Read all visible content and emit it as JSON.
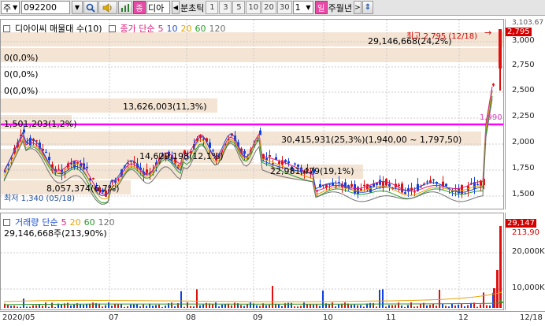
{
  "toolbar": {
    "market": "주",
    "code": "092200",
    "name": "디아",
    "period_label": "분초틱",
    "intervals": [
      "1",
      "3",
      "5",
      "10",
      "20",
      "30"
    ],
    "count": "1",
    "period_tabs": [
      "일",
      "주",
      "월",
      "년"
    ]
  },
  "price_panel": {
    "legend": {
      "stock": "디아이씨 매물대 수(10)",
      "ma_title": "종가 단순",
      "ma_periods": [
        {
          "label": "5",
          "color": "#e0187a"
        },
        {
          "label": "10",
          "color": "#2050d0"
        },
        {
          "label": "20",
          "color": "#e8a000"
        },
        {
          "label": "60",
          "color": "#2a9a2a"
        },
        {
          "label": "120",
          "color": "#707070"
        }
      ]
    },
    "volume_profile": [
      {
        "label": "29,146,668(24,2%)"
      },
      {
        "label": "0(0,0%)"
      },
      {
        "label": "0(0,0%)"
      },
      {
        "label": "0(0,0%)"
      },
      {
        "label": "13,626,003(11,3%)"
      },
      {
        "label": "1,501,203(1,2%)"
      },
      {
        "label": "30,415,931(25,3%)(1,940,00 ~ 1,797,50)"
      },
      {
        "label": "14,629,198(12,1%)"
      },
      {
        "label": "22,981,479(19,1%)"
      },
      {
        "label": "8,057,374(6,7%)"
      }
    ],
    "high_label": "최고 2,795 (12/18)",
    "low_label": "최저 1,340 (05/18)",
    "ref_line_value": "1,990",
    "y_ticks": [
      "3,000",
      "2,750",
      "2,500",
      "2,250",
      "2,000",
      "1,750",
      "1,500"
    ],
    "y_top": "3,103.67",
    "current_price": "2,795",
    "ref_line_color": "#ff00ff"
  },
  "volume_panel": {
    "legend": {
      "title": "거래량",
      "ma_title": "단순",
      "ma_periods": [
        {
          "label": "5",
          "color": "#e0187a"
        },
        {
          "label": "20",
          "color": "#e8a000"
        },
        {
          "label": "60",
          "color": "#2a9a2a"
        },
        {
          "label": "120",
          "color": "#707070"
        }
      ]
    },
    "info": "29,146,668주(213,90%)",
    "y_ticks": [
      "20,000K",
      "10,000K"
    ],
    "current_tag": "29,147",
    "pct_tag": "213,90"
  },
  "x_axis": {
    "ticks": [
      {
        "label": "2020/05",
        "x": 3
      },
      {
        "label": "07",
        "x": 138
      },
      {
        "label": "08",
        "x": 236
      },
      {
        "label": "09",
        "x": 321
      },
      {
        "label": "10",
        "x": 410
      },
      {
        "label": "11",
        "x": 490
      },
      {
        "label": "12",
        "x": 582
      },
      {
        "label": "12/18",
        "x": 660
      }
    ]
  }
}
